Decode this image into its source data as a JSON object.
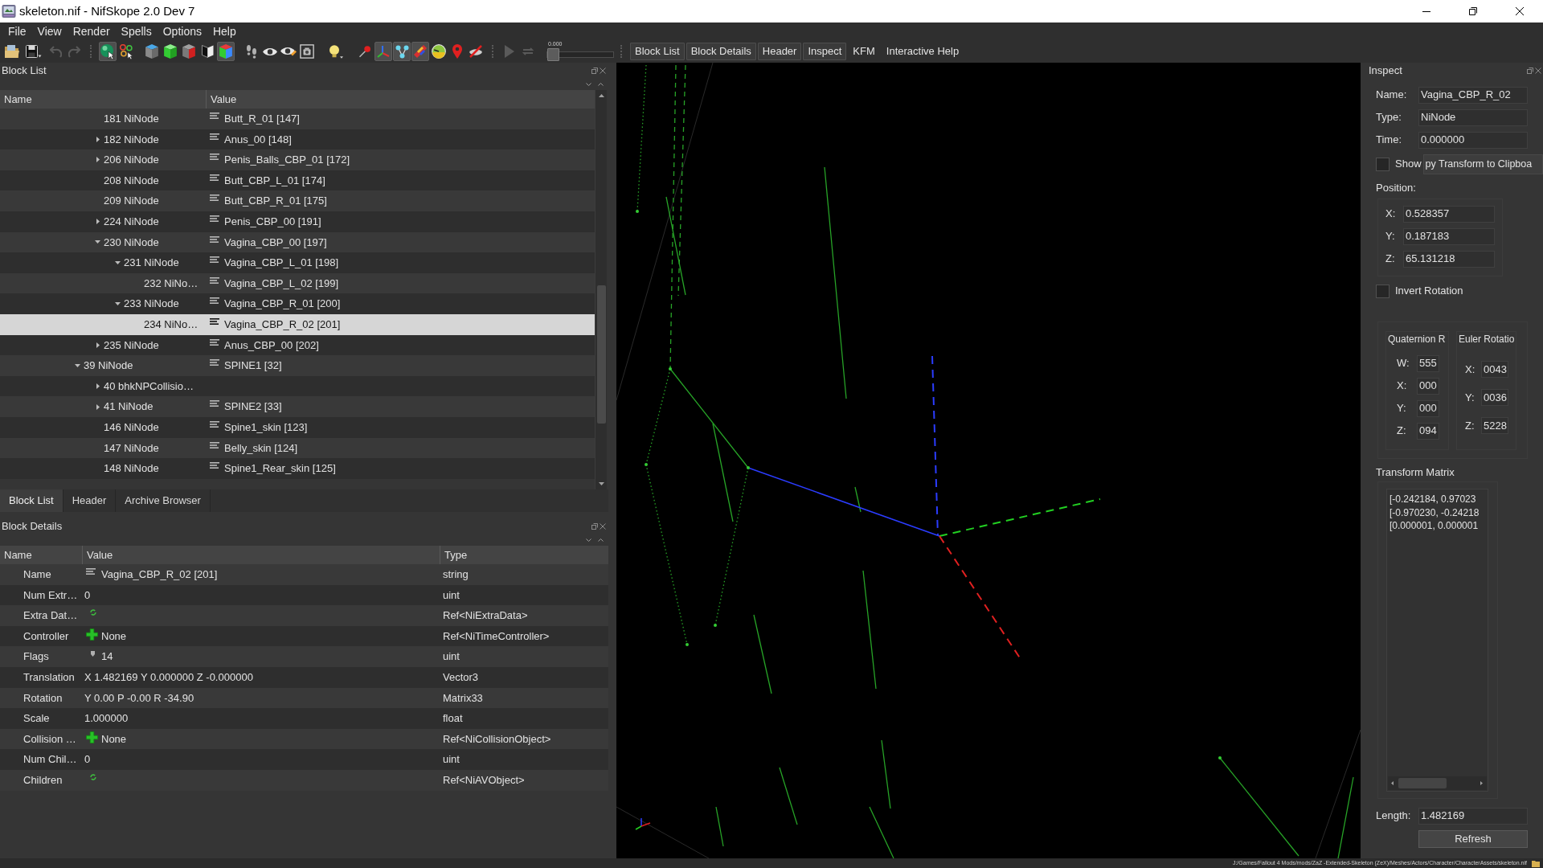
{
  "window": {
    "title": "skeleton.nif - NifSkope 2.0 Dev 7"
  },
  "menu": [
    "File",
    "View",
    "Render",
    "Spells",
    "Options",
    "Help"
  ],
  "toolbar": {
    "buttons": [
      {
        "pressed": false,
        "disabled": false
      },
      {
        "pressed": false,
        "disabled": false
      },
      {
        "pressed": false,
        "disabled": true
      },
      {
        "pressed": false,
        "disabled": true
      },
      {
        "pressed": true,
        "disabled": false
      },
      {
        "pressed": false,
        "disabled": false
      },
      {
        "pressed": false,
        "disabled": false
      },
      {
        "pressed": false,
        "disabled": false
      },
      {
        "pressed": false,
        "disabled": false
      },
      {
        "pressed": false,
        "disabled": false
      },
      {
        "pressed": true,
        "disabled": false
      },
      {
        "pressed": false,
        "disabled": false
      },
      {
        "pressed": false,
        "disabled": false
      },
      {
        "pressed": false,
        "disabled": false
      },
      {
        "pressed": false,
        "disabled": false
      },
      {
        "pressed": false,
        "disabled": false
      },
      {
        "pressed": false,
        "disabled": false
      },
      {
        "pressed": true,
        "disabled": false
      },
      {
        "pressed": true,
        "disabled": false
      },
      {
        "pressed": true,
        "disabled": false
      },
      {
        "pressed": false,
        "disabled": false
      },
      {
        "pressed": false,
        "disabled": false
      },
      {
        "pressed": false,
        "disabled": false
      },
      {
        "pressed": false,
        "disabled": true
      },
      {
        "pressed": false,
        "disabled": true
      }
    ],
    "slider": {
      "label": "0.000",
      "level": 0
    }
  },
  "dock_toggles": [
    {
      "label": "Block List",
      "checked": true
    },
    {
      "label": "Block Details",
      "checked": true
    },
    {
      "label": "Header",
      "checked": true
    },
    {
      "label": "Inspect",
      "checked": true
    },
    {
      "label": "KFM",
      "checked": false
    },
    {
      "label": "Interactive Help",
      "checked": false
    }
  ],
  "block_list": {
    "title": "Block List",
    "columns": [
      "Name",
      "Value"
    ],
    "continued_children": [
      {
        "name": "181 NiNode",
        "value": "Butt_R_01 [147]",
        "expandable": false,
        "selected": false
      },
      {
        "name": "182 NiNode",
        "value": "Anus_00 [148]",
        "expandable": true,
        "expanded": false,
        "selected": false
      },
      {
        "name": "206 NiNode",
        "value": "Penis_Balls_CBP_01 [172]",
        "expandable": true,
        "expanded": false,
        "selected": false
      },
      {
        "name": "208 NiNode",
        "value": "Butt_CBP_L_01 [174]",
        "expandable": false,
        "selected": false
      },
      {
        "name": "209 NiNode",
        "value": "Butt_CBP_R_01 [175]",
        "expandable": false,
        "selected": false
      },
      {
        "name": "224 NiNode",
        "value": "Penis_CBP_00 [191]",
        "expandable": true,
        "expanded": false,
        "selected": false
      },
      {
        "name": "230 NiNode",
        "value": "Vagina_CBP_00 [197]",
        "expandable": true,
        "expanded": true,
        "selected": false,
        "children": [
          {
            "name": "231 NiNode",
            "value": "Vagina_CBP_L_01 [198]",
            "expandable": true,
            "expanded": true,
            "selected": false,
            "children": [
              {
                "name": "232 NiNo…",
                "value": "Vagina_CBP_L_02 [199]",
                "expandable": false,
                "selected": false
              }
            ]
          },
          {
            "name": "233 NiNode",
            "value": "Vagina_CBP_R_01 [200]",
            "expandable": true,
            "expanded": true,
            "selected": false,
            "children": [
              {
                "name": "234 NiNo…",
                "value": "Vagina_CBP_R_02 [201]",
                "expandable": false,
                "selected": true
              }
            ]
          }
        ]
      },
      {
        "name": "235 NiNode",
        "value": "Anus_CBP_00 [202]",
        "expandable": true,
        "expanded": false,
        "selected": false
      }
    ],
    "rows": [
      {
        "name": "39 NiNode",
        "value": "SPINE1 [32]",
        "expandable": true,
        "expanded": true,
        "selected": false,
        "children": [
          {
            "name": "40 bhkNPCollisio…",
            "expandable": true,
            "expanded": false,
            "selected": false
          },
          {
            "name": "41 NiNode",
            "value": "SPINE2 [33]",
            "expandable": true,
            "expanded": false,
            "selected": false
          },
          {
            "name": "146 NiNode",
            "value": "Spine1_skin [123]",
            "expandable": false,
            "selected": false
          },
          {
            "name": "147 NiNode",
            "value": "Belly_skin [124]",
            "expandable": false,
            "selected": false
          },
          {
            "name": "148 NiNode",
            "value": "Spine1_Rear_skin [125]",
            "expandable": false,
            "selected": false
          }
        ]
      }
    ],
    "tabs": [
      {
        "label": "Block List",
        "selected": true
      },
      {
        "label": "Header",
        "selected": false
      },
      {
        "label": "Archive Browser",
        "selected": false
      }
    ]
  },
  "block_details": {
    "title": "Block Details",
    "columns": [
      "Name",
      "Value",
      "Type"
    ],
    "rows": [
      {
        "name": "Name",
        "kind": "string",
        "value": "Vagina_CBP_R_02 [201]",
        "type": "string"
      },
      {
        "name": "Num Extr…",
        "kind": "plain",
        "value": "0",
        "type": "uint"
      },
      {
        "name": "Extra Dat…",
        "kind": "array",
        "type": "Ref<NiExtraData>"
      },
      {
        "name": "Controller",
        "kind": "ref",
        "value": "None",
        "type": "Ref<NiTimeController>"
      },
      {
        "name": "Flags",
        "kind": "flags",
        "value": "14",
        "type": "uint"
      },
      {
        "name": "Translation",
        "kind": "plain",
        "value": "X 1.482169 Y 0.000000 Z -0.000000",
        "type": "Vector3"
      },
      {
        "name": "Rotation",
        "kind": "plain",
        "value": "Y 0.00 P -0.00 R -34.90",
        "type": "Matrix33"
      },
      {
        "name": "Scale",
        "kind": "plain",
        "value": "1.000000",
        "type": "float"
      },
      {
        "name": "Collision …",
        "kind": "ref",
        "value": "None",
        "type": "Ref<NiCollisionObject>"
      },
      {
        "name": "Num Chil…",
        "kind": "plain",
        "value": "0",
        "type": "uint"
      },
      {
        "name": "Children",
        "kind": "array",
        "type": "Ref<NiAVObject>"
      }
    ]
  },
  "inspect": {
    "title": "Inspect",
    "fields": [
      {
        "label": "Name:",
        "value": "Vagina_CBP_R_02"
      },
      {
        "label": "Type:",
        "value": "NiNode"
      },
      {
        "label": "Time:",
        "value": "0.000000"
      }
    ],
    "show_checkbox": {
      "label": "Show",
      "checked": false
    },
    "copy_button": {
      "label": "py Transform to Clipboa"
    },
    "position": {
      "label": "Position:",
      "fields": [
        {
          "label": "X:",
          "value": "0.528357"
        },
        {
          "label": "Y:",
          "value": "0.187183"
        },
        {
          "label": "Z:",
          "value": "65.131218"
        }
      ]
    },
    "invert_rotation": {
      "label": "Invert Rotation",
      "checked": false
    },
    "quaternion": {
      "title": "Quaternion R",
      "fields": [
        {
          "label": "W:",
          "value": "555"
        },
        {
          "label": "X:",
          "value": "000"
        },
        {
          "label": "Y:",
          "value": "000"
        },
        {
          "label": "Z:",
          "value": "094"
        }
      ]
    },
    "euler": {
      "title": "Euler Rotatio",
      "fields": [
        {
          "label": "X:",
          "value": "0043"
        },
        {
          "label": "Y:",
          "value": "0036"
        },
        {
          "label": "Z:",
          "value": "5228"
        }
      ]
    },
    "transform_matrix": {
      "label": "Transform Matrix",
      "lines": [
        "[-0.242184, 0.97023",
        "[-0.970230, -0.24218",
        "[0.000001, 0.000001"
      ]
    },
    "length": {
      "label": "Length:",
      "value": "1.482169"
    },
    "refresh_button": {
      "label": "Refresh"
    }
  },
  "status_bar": {
    "path": "J:/Games/Fallout 4 Mods/mods/ZaZ -Extended-Skeleton (ZeX)/Meshes/Actors/Character/CharacterAssets/skeleton.nif"
  }
}
